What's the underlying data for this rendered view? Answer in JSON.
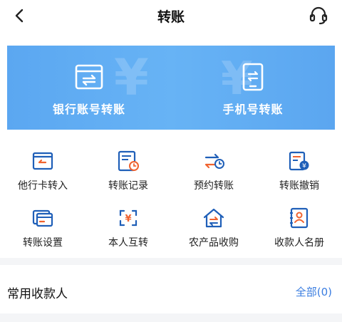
{
  "nav": {
    "title": "转账",
    "back_icon": "chevron-left-icon",
    "service_icon": "headset-icon"
  },
  "banner": {
    "items": [
      {
        "label": "银行账号转账",
        "icon": "bank-card-transfer-icon"
      },
      {
        "label": "手机号转账",
        "icon": "phone-transfer-icon"
      }
    ]
  },
  "grid": {
    "items": [
      {
        "label": "他行卡转入",
        "icon": "card-in-icon"
      },
      {
        "label": "转账记录",
        "icon": "transfer-record-icon"
      },
      {
        "label": "预约转账",
        "icon": "scheduled-transfer-icon"
      },
      {
        "label": "转账撤销",
        "icon": "transfer-cancel-icon"
      },
      {
        "label": "转账设置",
        "icon": "transfer-settings-icon"
      },
      {
        "label": "本人互转",
        "icon": "self-transfer-icon"
      },
      {
        "label": "农产品收购",
        "icon": "farm-purchase-icon"
      },
      {
        "label": "收款人名册",
        "icon": "payee-book-icon"
      }
    ]
  },
  "frequent": {
    "title": "常用收款人",
    "all_label": "全部(0)"
  },
  "colors": {
    "accent": "#3a7de0",
    "banner": "#62aef3",
    "orange": "#f0632f"
  }
}
